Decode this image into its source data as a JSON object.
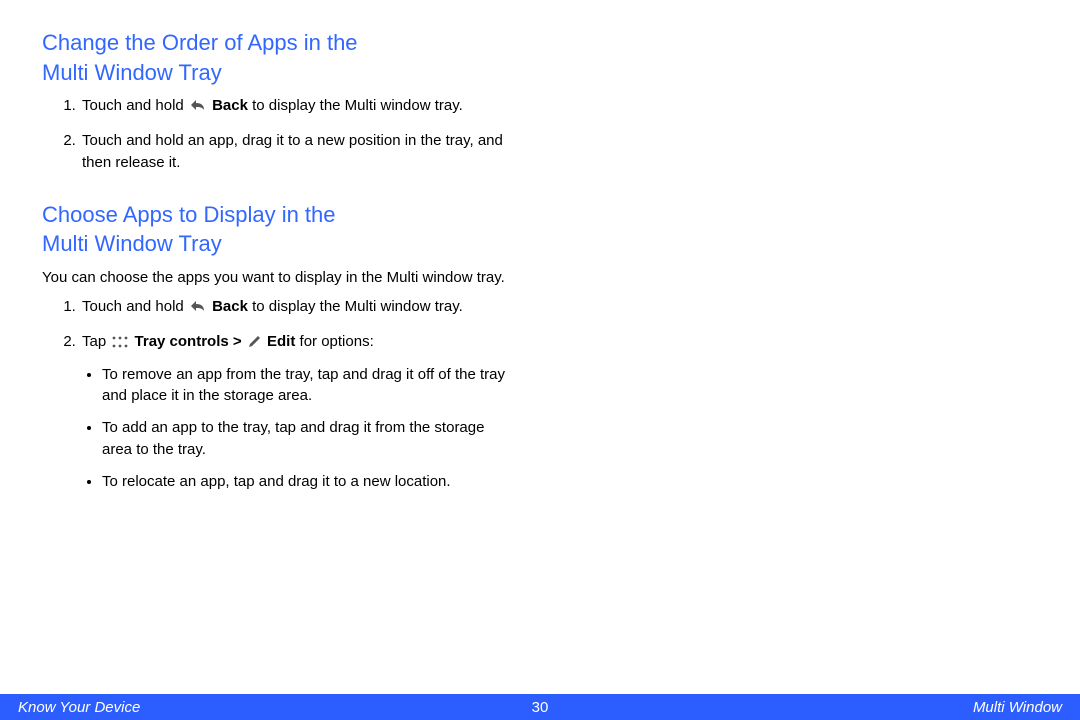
{
  "section1": {
    "heading_l1": "Change the Order of Apps in the",
    "heading_l2": "Multi Window Tray",
    "step1_a": "Touch and hold ",
    "step1_bold": "Back",
    "step1_b": " to display the Multi window tray.",
    "step2": "Touch and hold an app, drag it to a new position in the tray, and then release it."
  },
  "section2": {
    "heading_l1": "Choose Apps to Display in the",
    "heading_l2": "Multi Window Tray",
    "intro": "You can choose the apps you want to display in the Multi window tray.",
    "step1_a": "Touch and hold ",
    "step1_bold": "Back",
    "step1_b": " to display the Multi window tray.",
    "step2_a": "Tap ",
    "step2_bold1": "Tray controls",
    "step2_gt": " > ",
    "step2_bold2": "Edit",
    "step2_b": " for options:",
    "bullet1": "To remove an app from the tray, tap and drag it off of the tray and place it in the storage area.",
    "bullet2": "To add an app to the tray, tap and drag it from the storage area to the tray.",
    "bullet3": "To relocate an app, tap and drag it to a new location."
  },
  "footer": {
    "left": "Know Your Device",
    "center": "30",
    "right": "Multi Window"
  }
}
